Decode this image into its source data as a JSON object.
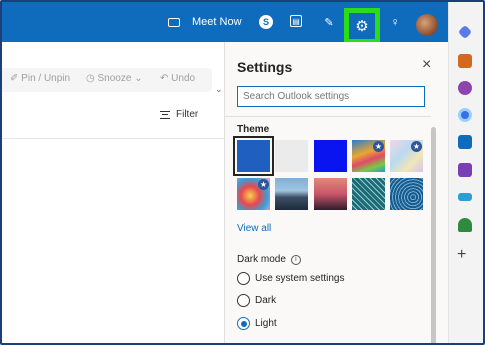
{
  "topbar": {
    "meet_now_label": "Meet Now",
    "accent_color": "#0f6cbd",
    "highlight_color": "#2bdd19"
  },
  "command_bar": {
    "pin_label": "Pin / Unpin",
    "snooze_label": "Snooze",
    "undo_label": "Undo"
  },
  "message_list": {
    "filter_label": "Filter"
  },
  "settings": {
    "title": "Settings",
    "close_label": "×",
    "search_placeholder": "Search Outlook settings",
    "theme_heading": "Theme",
    "themes": [
      {
        "name": "blue",
        "selected": true
      },
      {
        "name": "light-gray"
      },
      {
        "name": "bright-blue"
      },
      {
        "name": "rainbow",
        "premium": true
      },
      {
        "name": "pastel",
        "premium": true
      },
      {
        "name": "colorful-art",
        "premium": true
      },
      {
        "name": "mountains"
      },
      {
        "name": "palms"
      },
      {
        "name": "circuit"
      },
      {
        "name": "fingerprint"
      }
    ],
    "view_all_label": "View all",
    "dark_mode_label": "Dark mode",
    "dark_mode_options": [
      {
        "label": "Use system settings",
        "selected": false
      },
      {
        "label": "Dark",
        "selected": false
      },
      {
        "label": "Light",
        "selected": true
      }
    ]
  },
  "rail_icons": [
    "tag-icon",
    "briefcase-icon",
    "people-icon",
    "loop-icon",
    "outlook-icon",
    "notes-icon",
    "forms-icon",
    "tree-icon",
    "add-icon"
  ]
}
